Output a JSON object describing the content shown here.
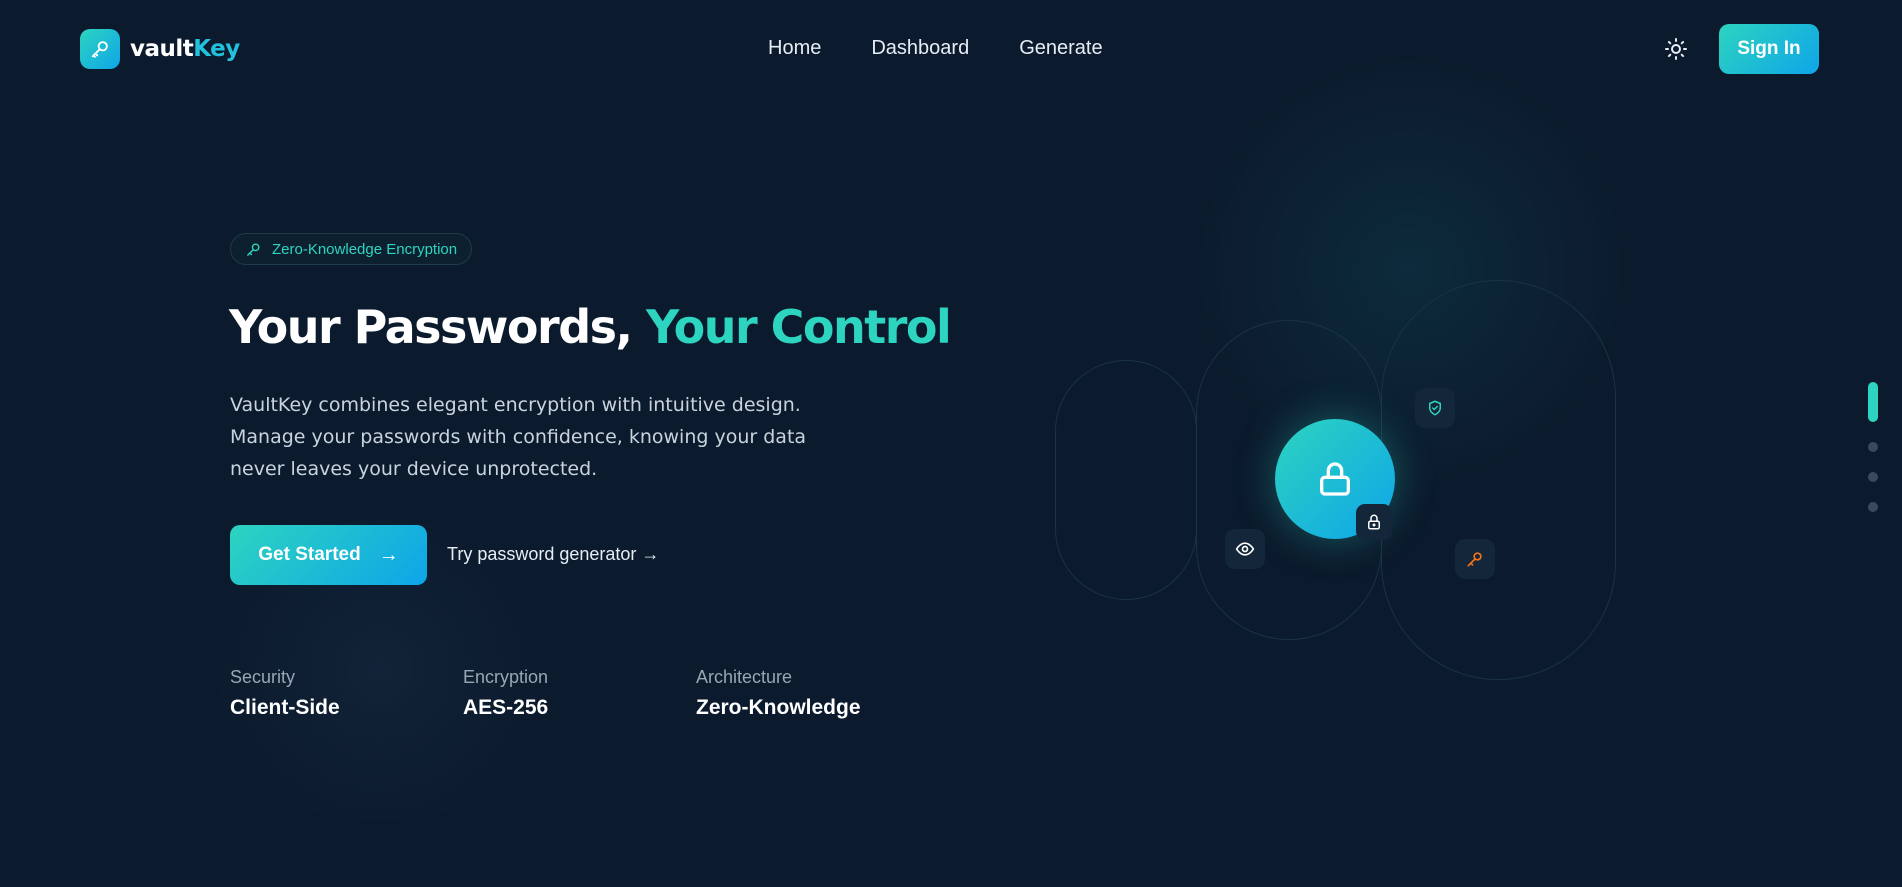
{
  "brand": {
    "name_part1": "vault",
    "name_part2": "Key",
    "accent": "#2dd4bf",
    "accent2": "#0ea5e9"
  },
  "nav": {
    "items": [
      "Home",
      "Dashboard",
      "Generate"
    ]
  },
  "header": {
    "signin_label": "Sign In",
    "theme_icon": "sun-icon"
  },
  "hero": {
    "badge": "Zero-Knowledge Encryption",
    "title_white": "Your Passwords,",
    "title_accent": "Your Control",
    "description": "VaultKey combines elegant encryption with intuitive design. Manage your passwords with confidence, knowing your data never leaves your device unprotected.",
    "cta_label": "Get Started",
    "secondary_link": "Try password generator →"
  },
  "stats": [
    {
      "label": "Security",
      "value": "Client-Side"
    },
    {
      "label": "Encryption",
      "value": "AES-256"
    },
    {
      "label": "Architecture",
      "value": "Zero-Knowledge"
    }
  ],
  "illustration": {
    "icons": [
      "lock-icon",
      "shield-icon",
      "eye-icon",
      "small-lock-icon",
      "key-icon"
    ]
  },
  "page_indicator": {
    "count": 4,
    "active": 0
  }
}
